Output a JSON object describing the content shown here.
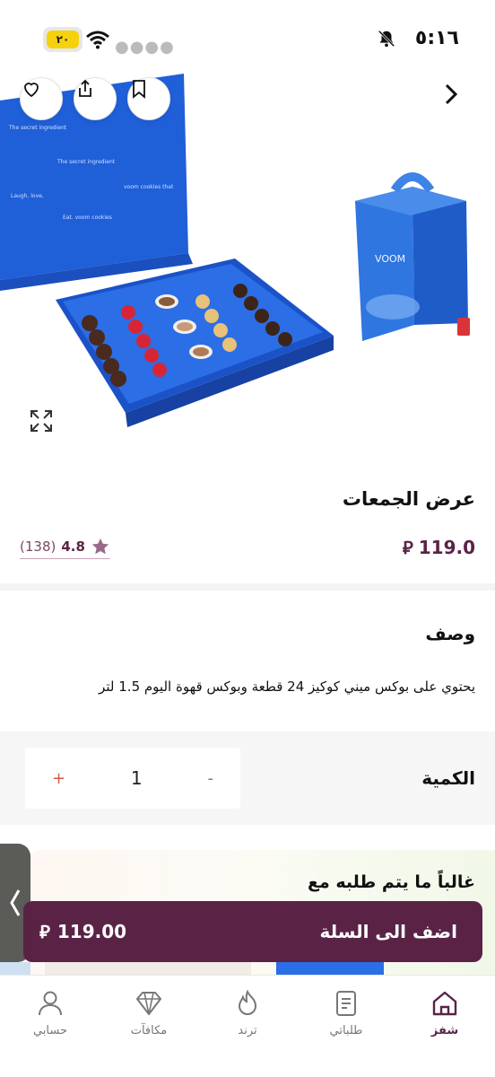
{
  "status_bar": {
    "time": "٥:١٦",
    "battery": "٢٠"
  },
  "product": {
    "title": "عرض الجمعات",
    "price": "119.0",
    "rating": "4.8",
    "reviews": "(138)"
  },
  "description": {
    "heading": "وصف",
    "text": "يحتوي على بوكس ميني كوكيز 24 قطعة وبوكس قهوة اليوم 1.5 لتر"
  },
  "quantity": {
    "label": "الكمية",
    "value": "1",
    "minus": "-",
    "plus": "+"
  },
  "suggestions": {
    "title": "غالباً ما يتم طلبه مع"
  },
  "cart": {
    "label": "اضف الى السلة",
    "price": "119.00"
  },
  "nav": {
    "items": [
      {
        "label": "شفز",
        "icon": "home-icon",
        "active": true
      },
      {
        "label": "طلباتي",
        "icon": "orders-icon"
      },
      {
        "label": "ترند",
        "icon": "flame-icon"
      },
      {
        "label": "مكافآت",
        "icon": "diamond-icon"
      },
      {
        "label": "حسابي",
        "icon": "profile-icon"
      }
    ]
  },
  "colors": {
    "brand": "#5a2346",
    "box_blue": "#1e5bd6"
  }
}
